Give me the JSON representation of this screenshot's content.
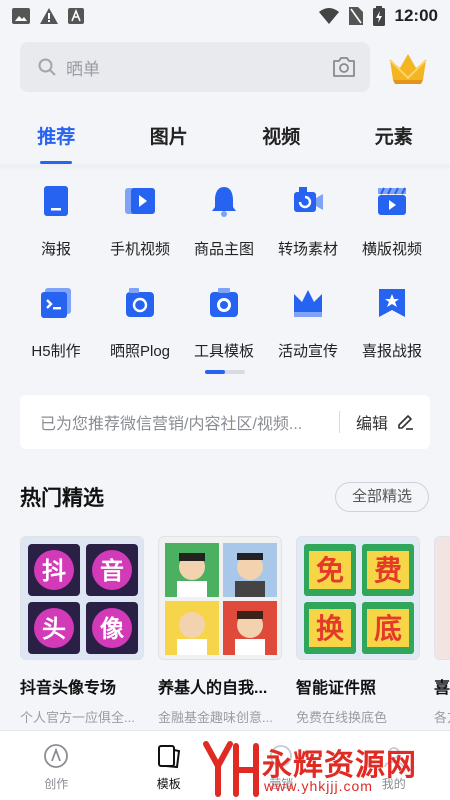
{
  "status_bar": {
    "time": "12:00"
  },
  "search": {
    "placeholder": "晒单"
  },
  "tabs": [
    {
      "label": "推荐",
      "active": true
    },
    {
      "label": "图片",
      "active": false
    },
    {
      "label": "视频",
      "active": false
    },
    {
      "label": "元素",
      "active": false
    }
  ],
  "categories": {
    "row1": [
      {
        "label": "海报",
        "icon": "poster-icon"
      },
      {
        "label": "手机视频",
        "icon": "phone-video-icon"
      },
      {
        "label": "商品主图",
        "icon": "bell-icon"
      },
      {
        "label": "转场素材",
        "icon": "camera-transition-icon"
      },
      {
        "label": "横版视频",
        "icon": "clapperboard-icon"
      }
    ],
    "row2": [
      {
        "label": "H5制作",
        "icon": "h5-icon"
      },
      {
        "label": "晒照Plog",
        "icon": "photo-camera-icon"
      },
      {
        "label": "工具模板",
        "icon": "shutter-icon"
      },
      {
        "label": "活动宣传",
        "icon": "crown-icon"
      },
      {
        "label": "喜报战报",
        "icon": "star-flag-icon"
      }
    ]
  },
  "pager": {
    "pages": 2,
    "current": 1
  },
  "recommend": {
    "text": "已为您推荐微信营销/内容社区/视频...",
    "edit_label": "编辑"
  },
  "section": {
    "title": "热门精选",
    "all_label": "全部精选"
  },
  "cards": [
    {
      "title": "抖音头像专场",
      "subtitle": "个人官方一应俱全...",
      "thumb_chars": [
        "抖",
        "音",
        "头",
        "像"
      ]
    },
    {
      "title": "养基人的自我...",
      "subtitle": "金融基金趣味创意..."
    },
    {
      "title": "智能证件照",
      "subtitle": "免费在线换底色",
      "thumb_chars": [
        "免",
        "费",
        "换",
        "底"
      ]
    },
    {
      "title": "喜",
      "subtitle": "各方"
    }
  ],
  "bottom_nav": [
    {
      "label": "创作",
      "active": false
    },
    {
      "label": "模板",
      "active": true
    },
    {
      "label": "营销",
      "active": false
    },
    {
      "label": "我的",
      "active": false
    }
  ],
  "watermark": {
    "text": "永辉资源网",
    "url": "www.yhkjjj.com"
  },
  "colors": {
    "accent": "#2663f0",
    "watermark": "#e02a24",
    "background": "#f4f5f9"
  }
}
